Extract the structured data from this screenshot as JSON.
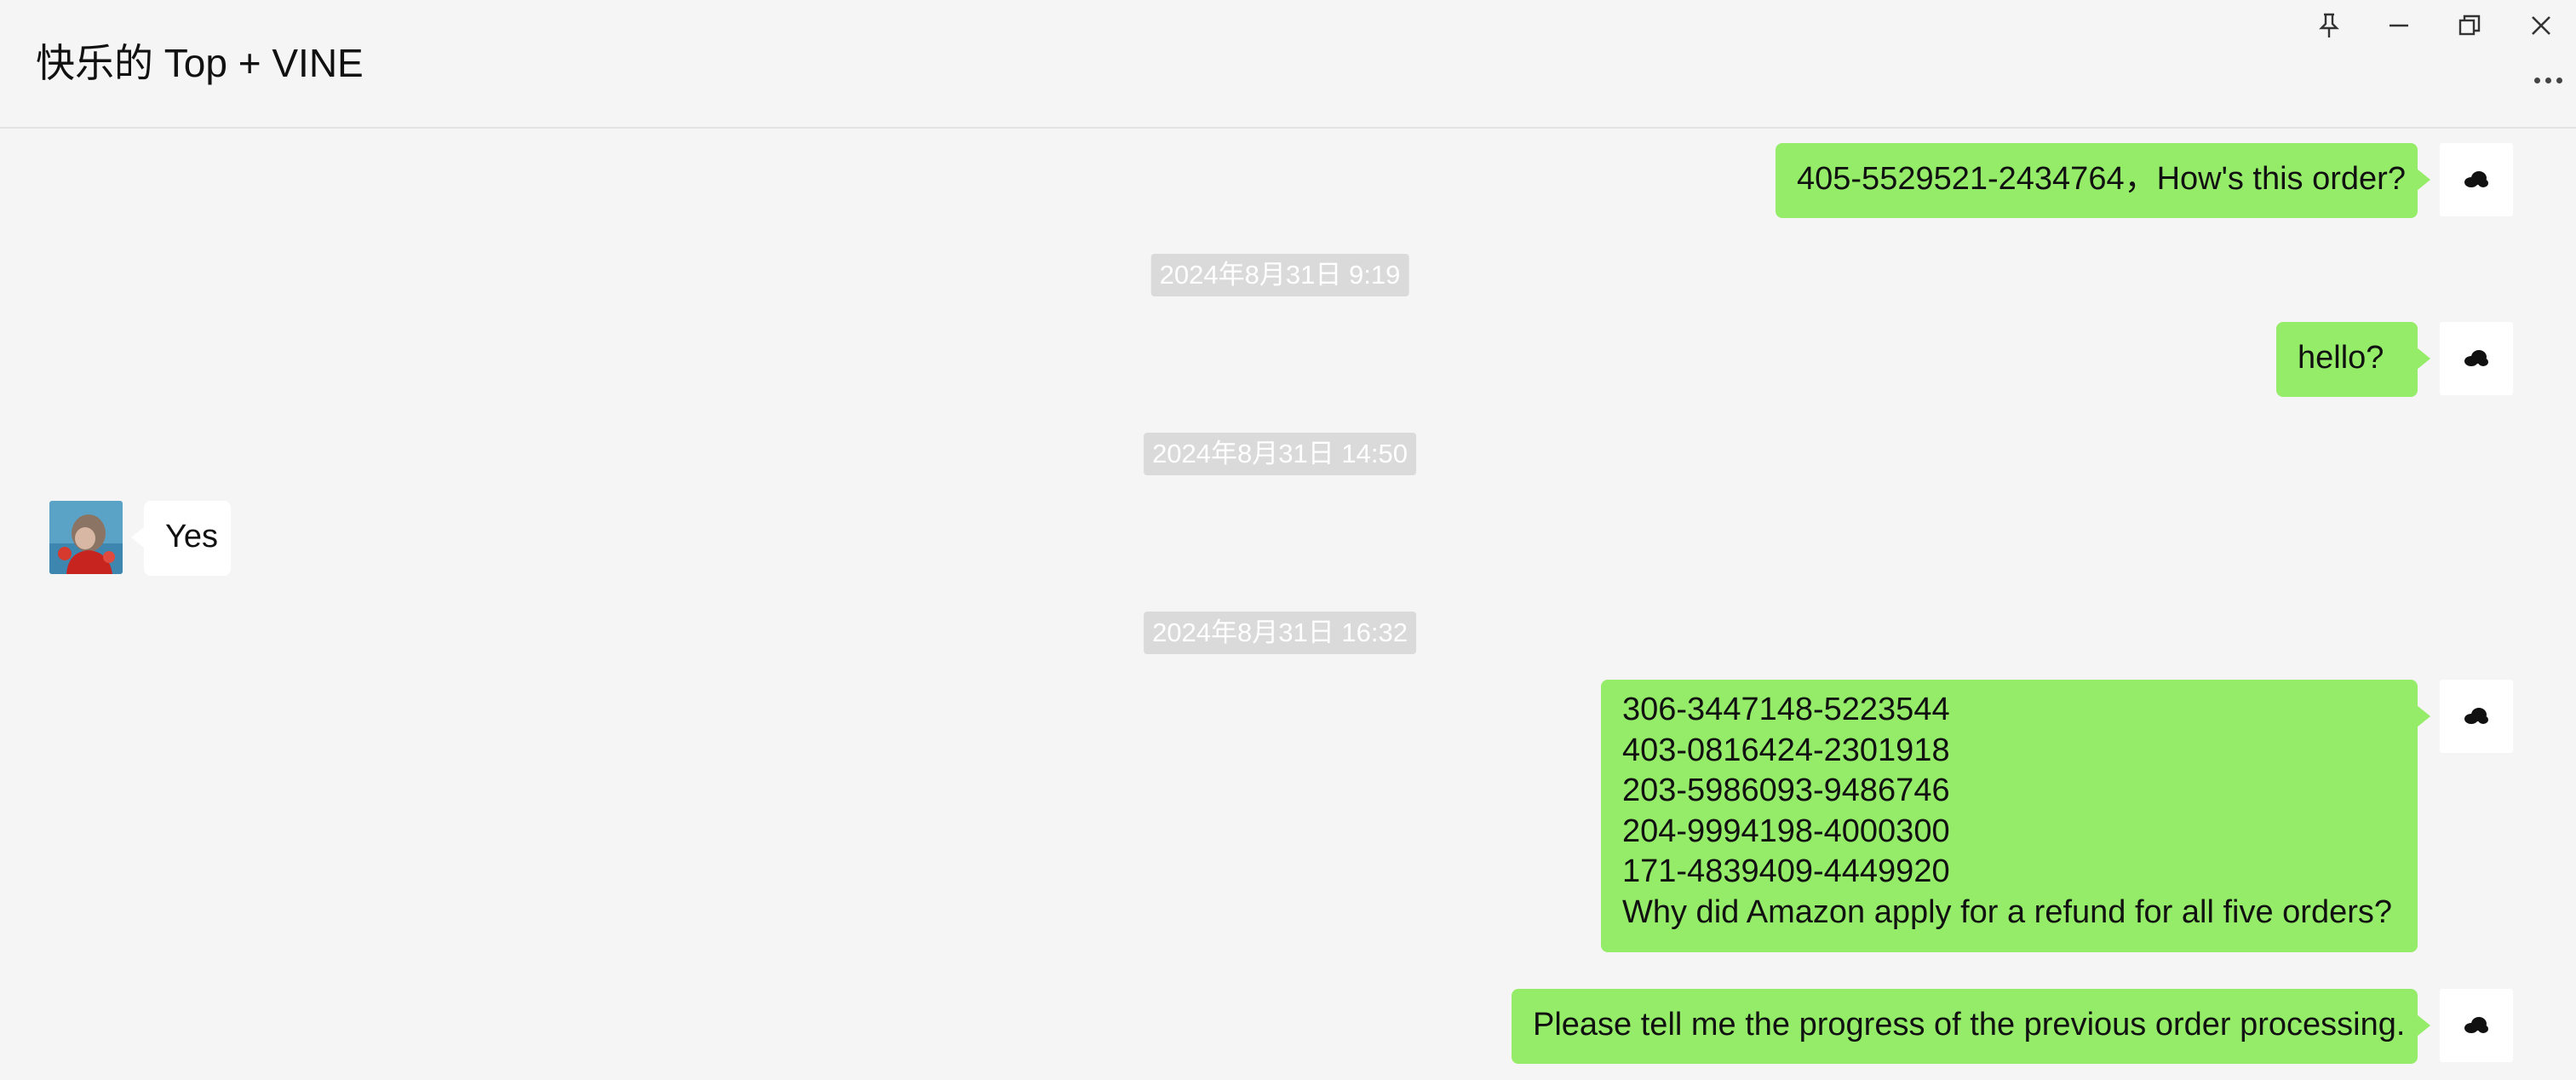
{
  "window": {
    "title": "快乐的 Top + VINE",
    "controls": [
      "pin-icon",
      "minimize-icon",
      "restore-icon",
      "close-icon"
    ],
    "more_icon": "more-icon"
  },
  "colors": {
    "background": "#f5f5f5",
    "outgoing_bubble": "#95ec69",
    "incoming_bubble": "#ffffff",
    "timestamp_bg": "#dadada"
  },
  "messages": [
    {
      "from": "self",
      "text": "405-5529521-2434764，How's this order?"
    },
    {
      "timestamp": "2024年8月31日 9:19"
    },
    {
      "from": "self",
      "text": "hello?"
    },
    {
      "timestamp": "2024年8月31日 14:50"
    },
    {
      "from": "other",
      "text": "Yes"
    },
    {
      "timestamp": "2024年8月31日 16:32"
    },
    {
      "from": "self",
      "lines": [
        "306-3447148-5223544",
        "403-0816424-2301918",
        "203-5986093-9486746",
        "204-9994198-4000300",
        "171-4839409-4449920",
        "Why did Amazon apply for a refund for all five orders?"
      ]
    },
    {
      "from": "self",
      "text": "Please tell me the progress of the previous order processing."
    }
  ]
}
